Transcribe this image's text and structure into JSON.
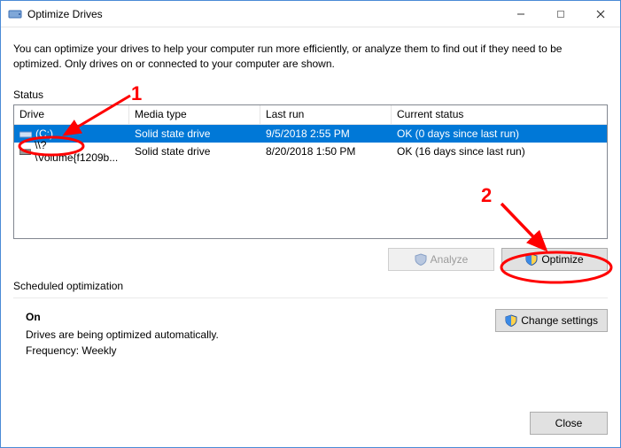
{
  "window": {
    "title": "Optimize Drives"
  },
  "description": "You can optimize your drives to help your computer run more efficiently, or analyze them to find out if they need to be optimized. Only drives on or connected to your computer are shown.",
  "status_label": "Status",
  "columns": {
    "drive": "Drive",
    "media": "Media type",
    "last": "Last run",
    "status": "Current status"
  },
  "rows": [
    {
      "drive": "(C:)",
      "media": "Solid state drive",
      "last": "9/5/2018 2:55 PM",
      "status": "OK (0 days since last run)",
      "selected": true
    },
    {
      "drive": "\\\\?\\Volume{f1209b...",
      "media": "Solid state drive",
      "last": "8/20/2018 1:50 PM",
      "status": "OK (16 days since last run)",
      "selected": false
    }
  ],
  "buttons": {
    "analyze": "Analyze",
    "optimize": "Optimize",
    "change_settings": "Change settings",
    "close": "Close"
  },
  "scheduled": {
    "heading": "Scheduled optimization",
    "state": "On",
    "desc": "Drives are being optimized automatically.",
    "freq": "Frequency: Weekly"
  },
  "annotations": {
    "one": "1",
    "two": "2"
  }
}
